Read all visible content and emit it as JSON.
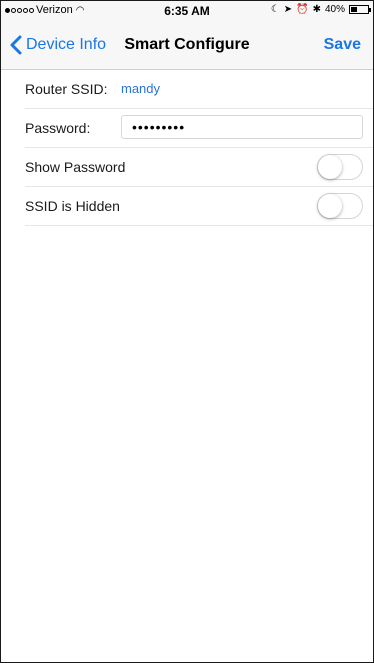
{
  "status_bar": {
    "carrier": "Verizon",
    "time": "6:35 AM",
    "battery": "40%",
    "battery_level": 0.4
  },
  "nav": {
    "back_label": "Device Info",
    "title": "Smart Configure",
    "save_label": "Save"
  },
  "form": {
    "ssid_label": "Router SSID:",
    "ssid_value": "mandy",
    "password_label": "Password:",
    "password_value": "•••••••••",
    "show_password_label": "Show Password",
    "show_password_on": false,
    "ssid_hidden_label": "SSID is Hidden",
    "ssid_hidden_on": false
  },
  "colors": {
    "accent": "#1977e6",
    "value_blue": "#2a72d6"
  }
}
